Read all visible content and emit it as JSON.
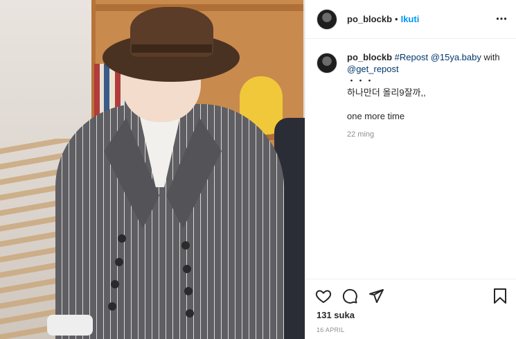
{
  "post": {
    "username": "po_blockb",
    "separator": "•",
    "follow_label": "Ikuti",
    "more_label": "•••"
  },
  "comment": {
    "username": "po_blockb",
    "repost_tag": "#Repost",
    "mention1": "@15ya.baby",
    "with_word": "with",
    "mention2": "@get_repost",
    "dots_line": "・・・",
    "korean_line": "하나만더 올리9잘까,,",
    "english_line": "one more time",
    "time_ago": "22 ming"
  },
  "actions": {
    "likes": "131 suka",
    "date": "16 APRIL"
  },
  "icons": [
    "heart-icon",
    "comment-icon",
    "share-icon",
    "bookmark-icon",
    "more-options-icon"
  ]
}
